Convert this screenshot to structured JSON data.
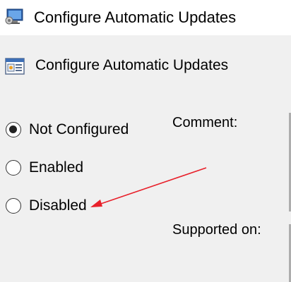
{
  "window": {
    "title": "Configure Automatic Updates",
    "title_icon": "policy-settings-icon"
  },
  "policy": {
    "name": "Configure Automatic Updates",
    "icon": "policy-setting-icon"
  },
  "options": [
    {
      "label": "Not Configured",
      "selected": true
    },
    {
      "label": "Enabled",
      "selected": false
    },
    {
      "label": "Disabled",
      "selected": false
    }
  ],
  "fields": {
    "comment_label": "Comment:",
    "supported_label": "Supported on:"
  },
  "annotation": {
    "arrow_color": "#e8202a",
    "points_to": "Disabled"
  }
}
